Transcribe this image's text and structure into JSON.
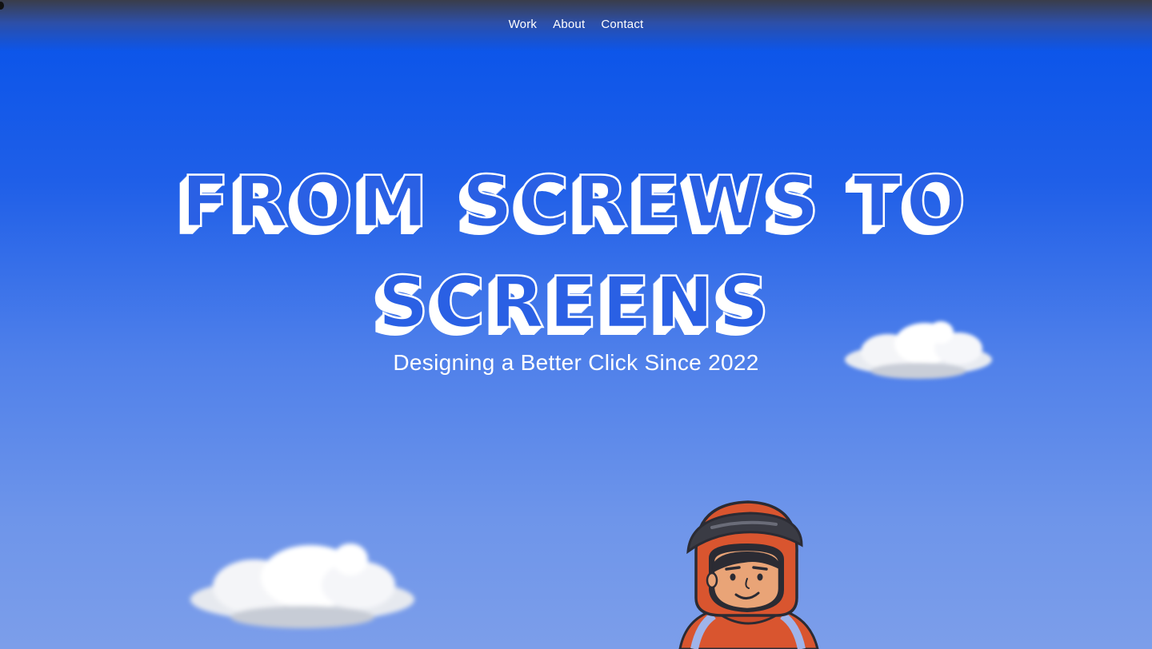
{
  "nav": {
    "items": [
      {
        "label": "Work"
      },
      {
        "label": "About"
      },
      {
        "label": "Contact"
      }
    ]
  },
  "hero": {
    "title_line1": "From Screws to",
    "title_line2": "Screens",
    "tagline": "Designing a Better Click Since 2022"
  },
  "decor": {
    "clouds": [
      "cloud-icon",
      "cloud-icon"
    ],
    "mascot": "helmet-rider-illustration"
  },
  "colors": {
    "sky_top": "#0652ea",
    "sky_bottom": "#7c9eea",
    "title_fill": "#2a60e4",
    "title_outline": "#ffffff",
    "helmet": "#d9552f",
    "visor": "#3a3b44",
    "skin": "#e9a477"
  }
}
